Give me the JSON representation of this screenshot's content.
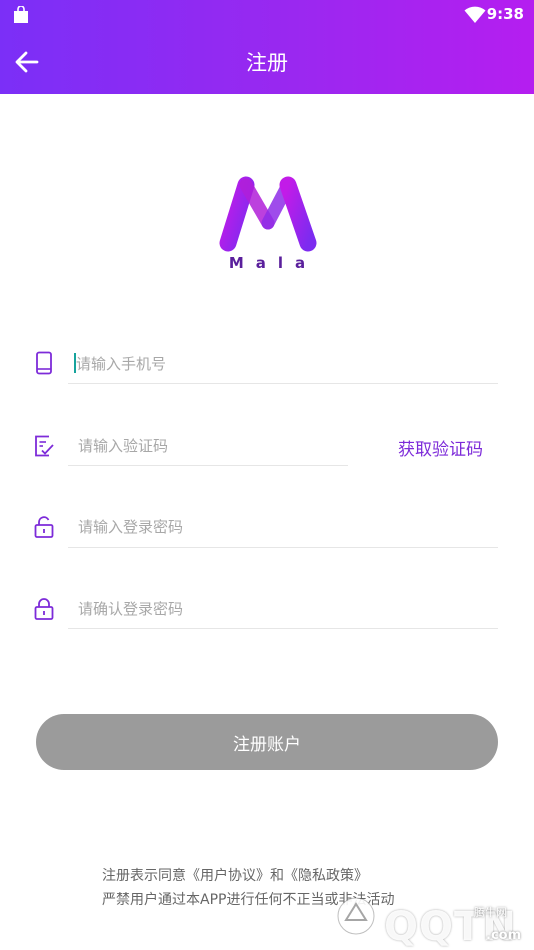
{
  "status_bar": {
    "time": "9:38",
    "icons": [
      "shopping-bag-icon",
      "wifi-icon",
      "battery-icon"
    ]
  },
  "header": {
    "title": "注册",
    "back_icon": "arrow-left-icon"
  },
  "logo": {
    "text": "Mala"
  },
  "form": {
    "phone_placeholder": "请输入手机号",
    "code_placeholder": "请输入验证码",
    "get_code_label": "获取验证码",
    "password_placeholder": "请输入登录密码",
    "confirm_password_placeholder": "请确认登录密码",
    "submit_label": "注册账户"
  },
  "terms": {
    "prefix": "注册表示同意",
    "user_agreement": "《用户协议》",
    "and": "和",
    "privacy_policy": "《隐私政策》",
    "warning": "严禁用户通过本APP进行任何不正当或非法活动"
  },
  "watermark": {
    "brand": "QQTN",
    "site_cn": "腾牛网",
    "domain": ".com"
  },
  "colors": {
    "header_gradient_start": "#7b2ff7",
    "header_gradient_end": "#b51ef0",
    "accent": "#7d2bd9",
    "submit_disabled": "#9b9b9b"
  }
}
